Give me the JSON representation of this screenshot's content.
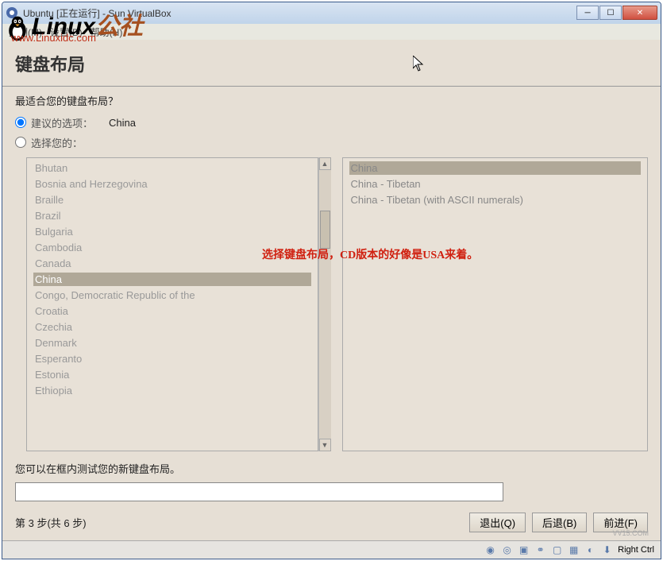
{
  "window": {
    "title": "Ubuntu [正在运行] - Sun VirtualBox"
  },
  "menubar": {
    "items": [
      "控制(M)",
      "设置(D)",
      "帮助(H)"
    ]
  },
  "page": {
    "title": "键盘布局",
    "question": "最适合您的键盘布局？",
    "radio_suggested_label": "建议的选项：",
    "radio_suggested_value": "China",
    "radio_choose_label": "选择您的：",
    "test_label": "您可以在框内测试您的新键盘布局。",
    "step_label": "第 3 步(共 6 步)"
  },
  "left_list": [
    {
      "label": "Bhutan",
      "selected": false
    },
    {
      "label": "Bosnia and Herzegovina",
      "selected": false
    },
    {
      "label": "Braille",
      "selected": false
    },
    {
      "label": "Brazil",
      "selected": false
    },
    {
      "label": "Bulgaria",
      "selected": false
    },
    {
      "label": "Cambodia",
      "selected": false
    },
    {
      "label": "Canada",
      "selected": false
    },
    {
      "label": "China",
      "selected": true
    },
    {
      "label": "Congo, Democratic Republic of the",
      "selected": false
    },
    {
      "label": "Croatia",
      "selected": false
    },
    {
      "label": "Czechia",
      "selected": false
    },
    {
      "label": "Denmark",
      "selected": false
    },
    {
      "label": "Esperanto",
      "selected": false
    },
    {
      "label": "Estonia",
      "selected": false
    },
    {
      "label": "Ethiopia",
      "selected": false
    }
  ],
  "right_list": [
    {
      "label": "China",
      "selected": true
    },
    {
      "label": "China - Tibetan",
      "selected": false
    },
    {
      "label": "China - Tibetan (with ASCII numerals)",
      "selected": false
    }
  ],
  "buttons": {
    "quit": "退出(Q)",
    "back": "后退(B)",
    "forward": "前进(F)"
  },
  "statusbar": {
    "host_key": "Right Ctrl"
  },
  "watermarks": {
    "logo_text": "Linux",
    "logo_suffix": "公社",
    "url": "www.Linuxidc.com",
    "annotation": "选择键盘布局，CD版本的好像是USA来着。",
    "vv": "VV15.COM"
  }
}
